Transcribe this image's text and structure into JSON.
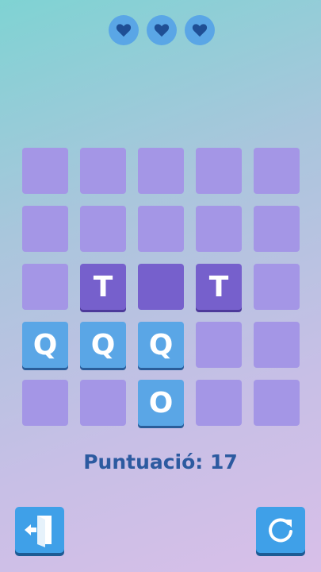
{
  "lives": {
    "count": 3,
    "icon": "heart-icon",
    "color": "#1f4f95"
  },
  "board": {
    "rows": [
      [
        {
          "letter": "",
          "style": "empty"
        },
        {
          "letter": "",
          "style": "empty"
        },
        {
          "letter": "",
          "style": "empty"
        },
        {
          "letter": "",
          "style": "empty"
        },
        {
          "letter": "",
          "style": "empty"
        }
      ],
      [
        {
          "letter": "",
          "style": "empty"
        },
        {
          "letter": "",
          "style": "empty"
        },
        {
          "letter": "",
          "style": "empty"
        },
        {
          "letter": "",
          "style": "empty"
        },
        {
          "letter": "",
          "style": "empty"
        }
      ],
      [
        {
          "letter": "",
          "style": "empty"
        },
        {
          "letter": "T",
          "style": "dark"
        },
        {
          "letter": "",
          "style": "selected"
        },
        {
          "letter": "T",
          "style": "dark"
        },
        {
          "letter": "",
          "style": "empty"
        }
      ],
      [
        {
          "letter": "Q",
          "style": "blue"
        },
        {
          "letter": "Q",
          "style": "blue"
        },
        {
          "letter": "Q",
          "style": "blue"
        },
        {
          "letter": "",
          "style": "empty"
        },
        {
          "letter": "",
          "style": "empty"
        }
      ],
      [
        {
          "letter": "",
          "style": "empty"
        },
        {
          "letter": "",
          "style": "empty"
        },
        {
          "letter": "O",
          "style": "blue"
        },
        {
          "letter": "",
          "style": "empty"
        },
        {
          "letter": "",
          "style": "empty"
        }
      ]
    ]
  },
  "score": {
    "text": "Puntuació: 17"
  },
  "buttons": {
    "exit": {
      "icon": "exit-door-icon"
    },
    "restart": {
      "icon": "restart-icon"
    }
  },
  "colors": {
    "empty": "#a496e6",
    "dark": "#7660cc",
    "blue": "#5aa6e6",
    "text": "#2c5aa0"
  }
}
